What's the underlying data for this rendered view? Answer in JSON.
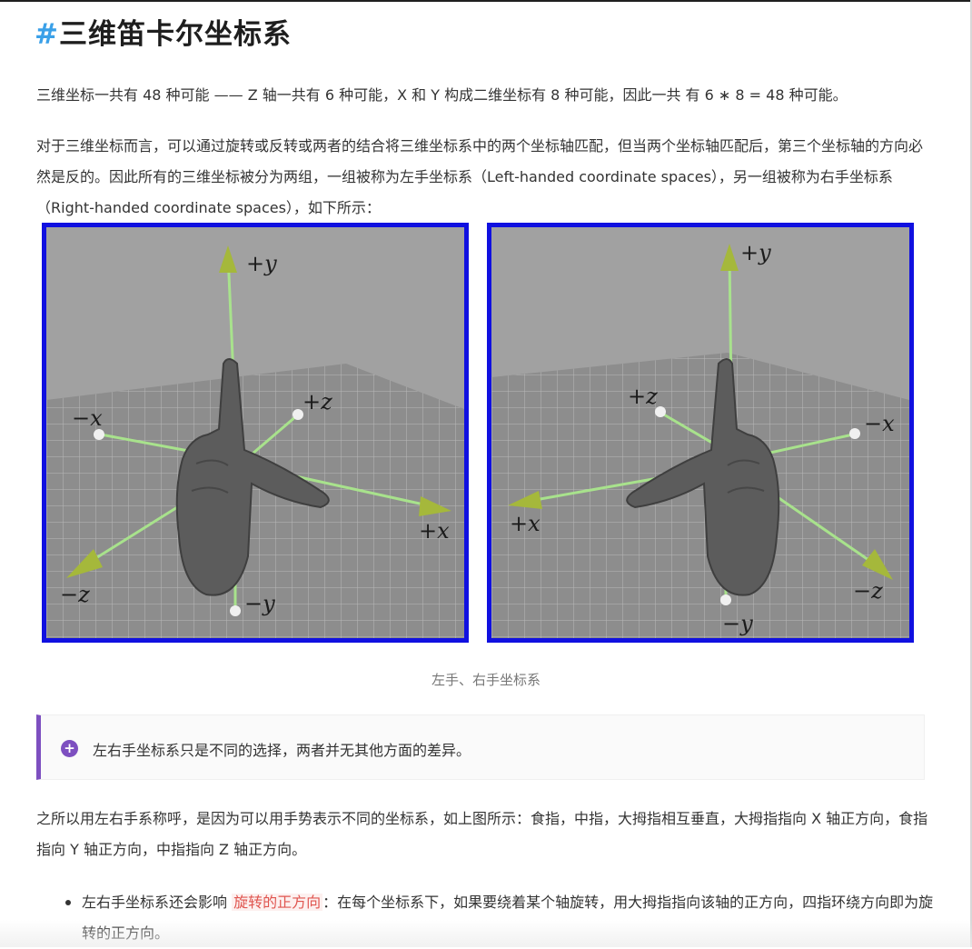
{
  "heading": {
    "hash": "#",
    "title": "三维笛卡尔坐标系"
  },
  "paragraphs": {
    "p1": "三维坐标一共有 48 种可能 —— Z 轴一共有 6 种可能，X 和 Y 构成二维坐标有 8 种可能，因此一共 有 6 ∗ 8 = 48 种可能。",
    "p2": "对于三维坐标而言，可以通过旋转或反转或两者的结合将三维坐标系中的两个坐标轴匹配，但当两个坐标轴匹配后，第三个坐标轴的方向必然是反的。因此所有的三维坐标被分为两组，一组被称为左手坐标系（Left-handed coordinate spaces），另一组被称为右手坐标系（Right-handed coordinate spaces），如下所示：",
    "p3": "之所以用左右手系称呼，是因为可以用手势表示不同的坐标系，如上图所示：食指，中指，大拇指相互垂直，大拇指指向 X 轴正方向，食指指向 Y 轴正方向，中指指向 Z 轴正方向。"
  },
  "figure": {
    "caption": "左手、右手坐标系",
    "left": {
      "plus_y": "+y",
      "minus_x": "−x",
      "plus_z": "+z",
      "plus_x": "+x",
      "minus_z": "−z",
      "minus_y": "−y"
    },
    "right": {
      "plus_y": "+y",
      "plus_z": "+z",
      "minus_x": "−x",
      "plus_x": "+x",
      "minus_z": "−z",
      "minus_y": "−y"
    }
  },
  "note": {
    "text": "左右手坐标系只是不同的选择，两者并无其他方面的差异。",
    "icon": "plus-circle-icon"
  },
  "bullet": {
    "before": "左右手坐标系还会影响 ",
    "highlight": "旋转的正方向",
    "after": "：在每个坐标系下，如果要绕着某个轴旋转，用大拇指指向该轴的正方向，四指环绕方向即为旋转的正方向。"
  },
  "colors": {
    "accent_blue": "#3aa0e8",
    "frame_blue": "#1010e0",
    "note_purple": "#7d4fc0",
    "highlight_red": "#e0554f"
  }
}
